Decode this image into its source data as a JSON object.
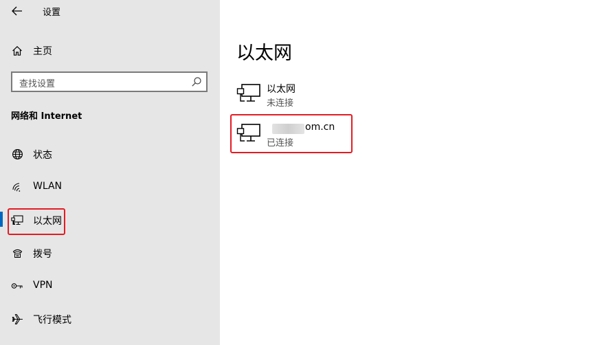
{
  "window": {
    "title": "设置"
  },
  "sidebar": {
    "home_label": "主页",
    "search": {
      "placeholder": "查找设置"
    },
    "section_heading": "网络和 Internet",
    "items": [
      {
        "label": "状态",
        "icon": "globe-icon",
        "selected": false
      },
      {
        "label": "WLAN",
        "icon": "wifi-icon",
        "selected": false
      },
      {
        "label": "以太网",
        "icon": "ethernet-icon",
        "selected": true
      },
      {
        "label": "拨号",
        "icon": "dialup-icon",
        "selected": false
      },
      {
        "label": "VPN",
        "icon": "vpn-icon",
        "selected": false
      },
      {
        "label": "飞行模式",
        "icon": "airplane-icon",
        "selected": false
      }
    ]
  },
  "main": {
    "title": "以太网",
    "connections": [
      {
        "name": "以太网",
        "status": "未连接",
        "icon": "ethernet-icon"
      },
      {
        "name_visible_suffix": "om.cn",
        "status": "已连接",
        "icon": "ethernet-icon",
        "name_obscured": true
      }
    ]
  },
  "colors": {
    "accent": "#0067c0",
    "highlight": "#e31b23",
    "sidebar_bg": "#e6e6e6"
  }
}
